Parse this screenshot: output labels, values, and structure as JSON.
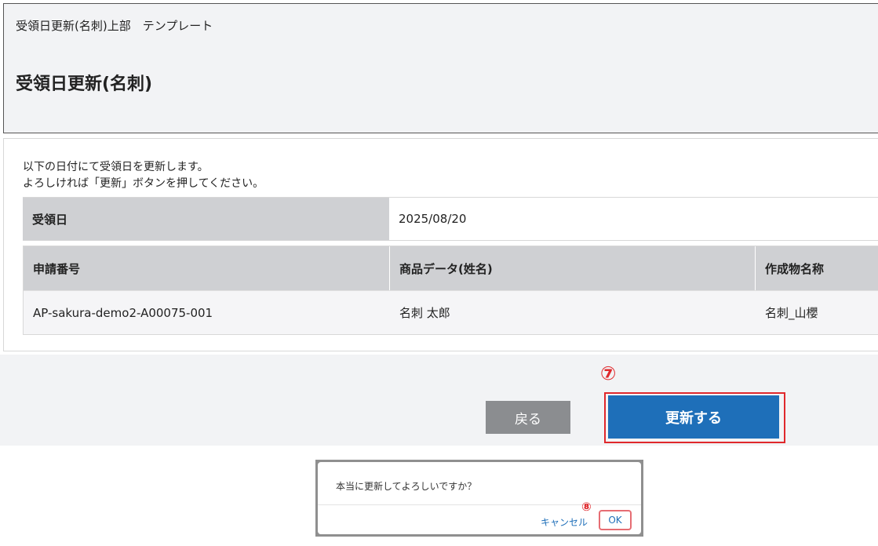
{
  "header": {
    "template_label": "受領日更新(名刺)上部　テンプレート",
    "page_title": "受領日更新(名刺)"
  },
  "content": {
    "intro_line1": "以下の日付にて受領日を更新します。",
    "intro_line2": "よろしければ「更新」ボタンを押してください。",
    "date_label": "受領日",
    "date_value": "2025/08/20",
    "table": {
      "headers": [
        "申請番号",
        "商品データ(姓名)",
        "作成物名称"
      ],
      "rows": [
        [
          "AP-sakura-demo2-A00075-001",
          "名刺 太郎",
          "名刺_山櫻"
        ]
      ]
    }
  },
  "actions": {
    "back_label": "戻る",
    "update_label": "更新する",
    "step7_marker": "⑦"
  },
  "dialog": {
    "message": "本当に更新してよろしいですか？",
    "cancel_label": "キャンセル",
    "ok_label": "OK",
    "step8_marker": "⑧"
  },
  "colors": {
    "primary": "#1e6fb9",
    "back_button": "#8b8d90",
    "highlight": "#e0282c"
  }
}
